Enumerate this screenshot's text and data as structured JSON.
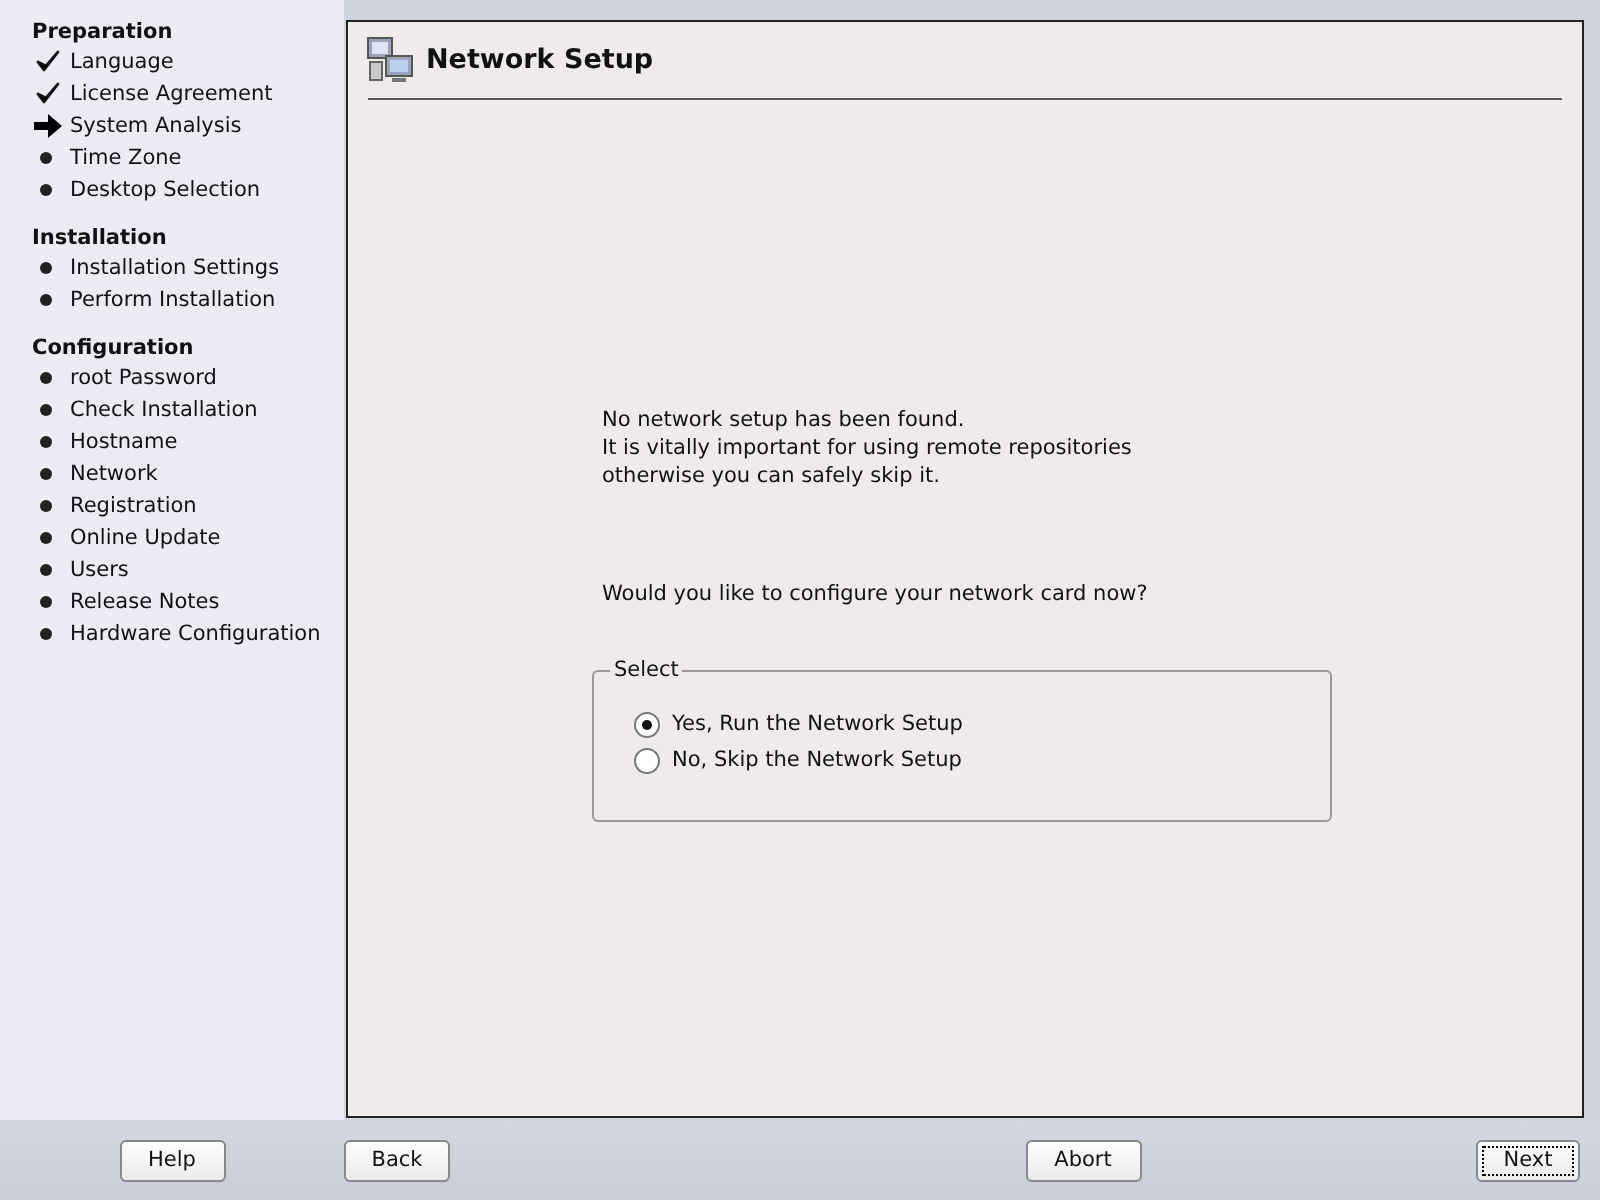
{
  "sidebar": {
    "sections": [
      {
        "title": "Preparation",
        "items": [
          {
            "label": "Language",
            "kind": "done"
          },
          {
            "label": "License Agreement",
            "kind": "done"
          },
          {
            "label": "System Analysis",
            "kind": "current"
          },
          {
            "label": "Time Zone",
            "kind": "pending"
          },
          {
            "label": "Desktop Selection",
            "kind": "pending"
          }
        ]
      },
      {
        "title": "Installation",
        "items": [
          {
            "label": "Installation Settings",
            "kind": "pending"
          },
          {
            "label": "Perform Installation",
            "kind": "pending"
          }
        ]
      },
      {
        "title": "Configuration",
        "items": [
          {
            "label": "root Password",
            "kind": "pending"
          },
          {
            "label": "Check Installation",
            "kind": "pending"
          },
          {
            "label": "Hostname",
            "kind": "pending"
          },
          {
            "label": "Network",
            "kind": "pending"
          },
          {
            "label": "Registration",
            "kind": "pending"
          },
          {
            "label": "Online Update",
            "kind": "pending"
          },
          {
            "label": "Users",
            "kind": "pending"
          },
          {
            "label": "Release Notes",
            "kind": "pending"
          },
          {
            "label": "Hardware Configuration",
            "kind": "pending"
          }
        ]
      }
    ]
  },
  "dialog": {
    "title": "Network Setup",
    "message": [
      "No network setup has been found.",
      "It is vitally important for using remote repositories",
      "otherwise you can safely skip it."
    ],
    "question": "Would you like to configure your network card now?",
    "group": {
      "title": "Select",
      "options": [
        {
          "label": "Yes, Run the Network Setup",
          "selected": true
        },
        {
          "label": "No, Skip the Network Setup",
          "selected": false
        }
      ]
    }
  },
  "buttons": [
    {
      "label": "Help",
      "kind": "help"
    },
    {
      "label": "Back",
      "kind": "back"
    },
    {
      "label": "Abort",
      "kind": "abort"
    },
    {
      "label": "Next",
      "kind": "next",
      "focused": true
    }
  ]
}
